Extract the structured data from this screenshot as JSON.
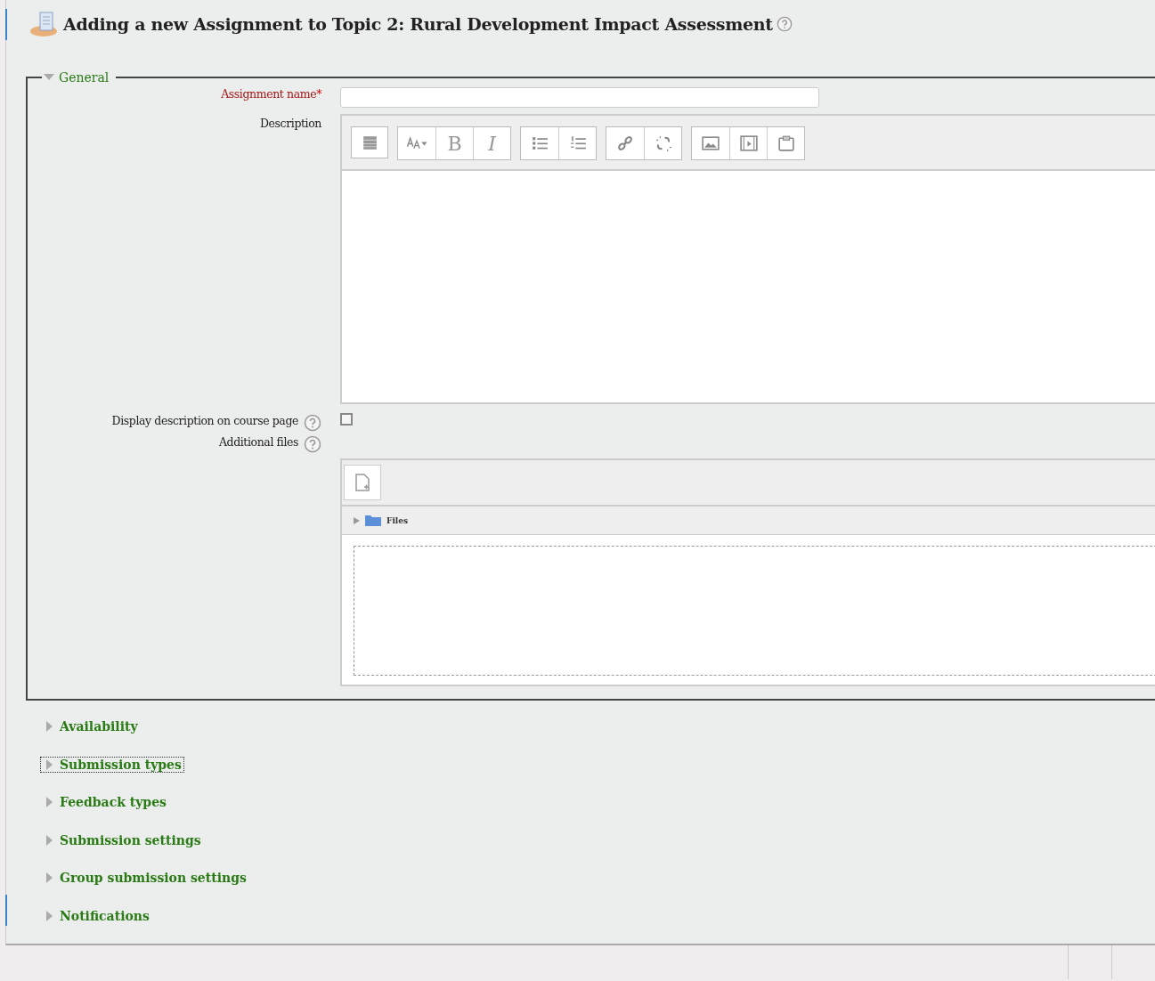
{
  "page": {
    "title": "Adding a new Assignment to Topic 2: Rural Development Impact Assessment"
  },
  "general": {
    "legend": "General",
    "expanded": true,
    "assignment_name": {
      "label": "Assignment name",
      "required_mark": "*"
    },
    "description": {
      "label": "Description",
      "toolbar": [
        [
          {
            "kind": "toggle"
          }
        ],
        [
          {
            "kind": "font-size"
          },
          {
            "kind": "bold",
            "label": "B"
          },
          {
            "kind": "italic",
            "label": "I"
          }
        ],
        [
          {
            "kind": "bullets"
          },
          {
            "kind": "numbers"
          }
        ],
        [
          {
            "kind": "link"
          },
          {
            "kind": "unlink"
          }
        ],
        [
          {
            "kind": "image"
          },
          {
            "kind": "media"
          },
          {
            "kind": "paste"
          }
        ]
      ]
    },
    "display_description": {
      "label": "Display description on course page",
      "checked": false
    },
    "additional_files": {
      "label": "Additional files",
      "folder": "Files"
    }
  },
  "sections": [
    {
      "label": "Availability",
      "expanded": false,
      "focused": false
    },
    {
      "label": "Submission types",
      "expanded": false,
      "focused": true
    },
    {
      "label": "Feedback types",
      "expanded": false,
      "focused": false
    },
    {
      "label": "Submission settings",
      "expanded": false,
      "focused": false
    },
    {
      "label": "Group submission settings",
      "expanded": false,
      "focused": false
    },
    {
      "label": "Notifications",
      "expanded": false,
      "focused": false
    }
  ]
}
